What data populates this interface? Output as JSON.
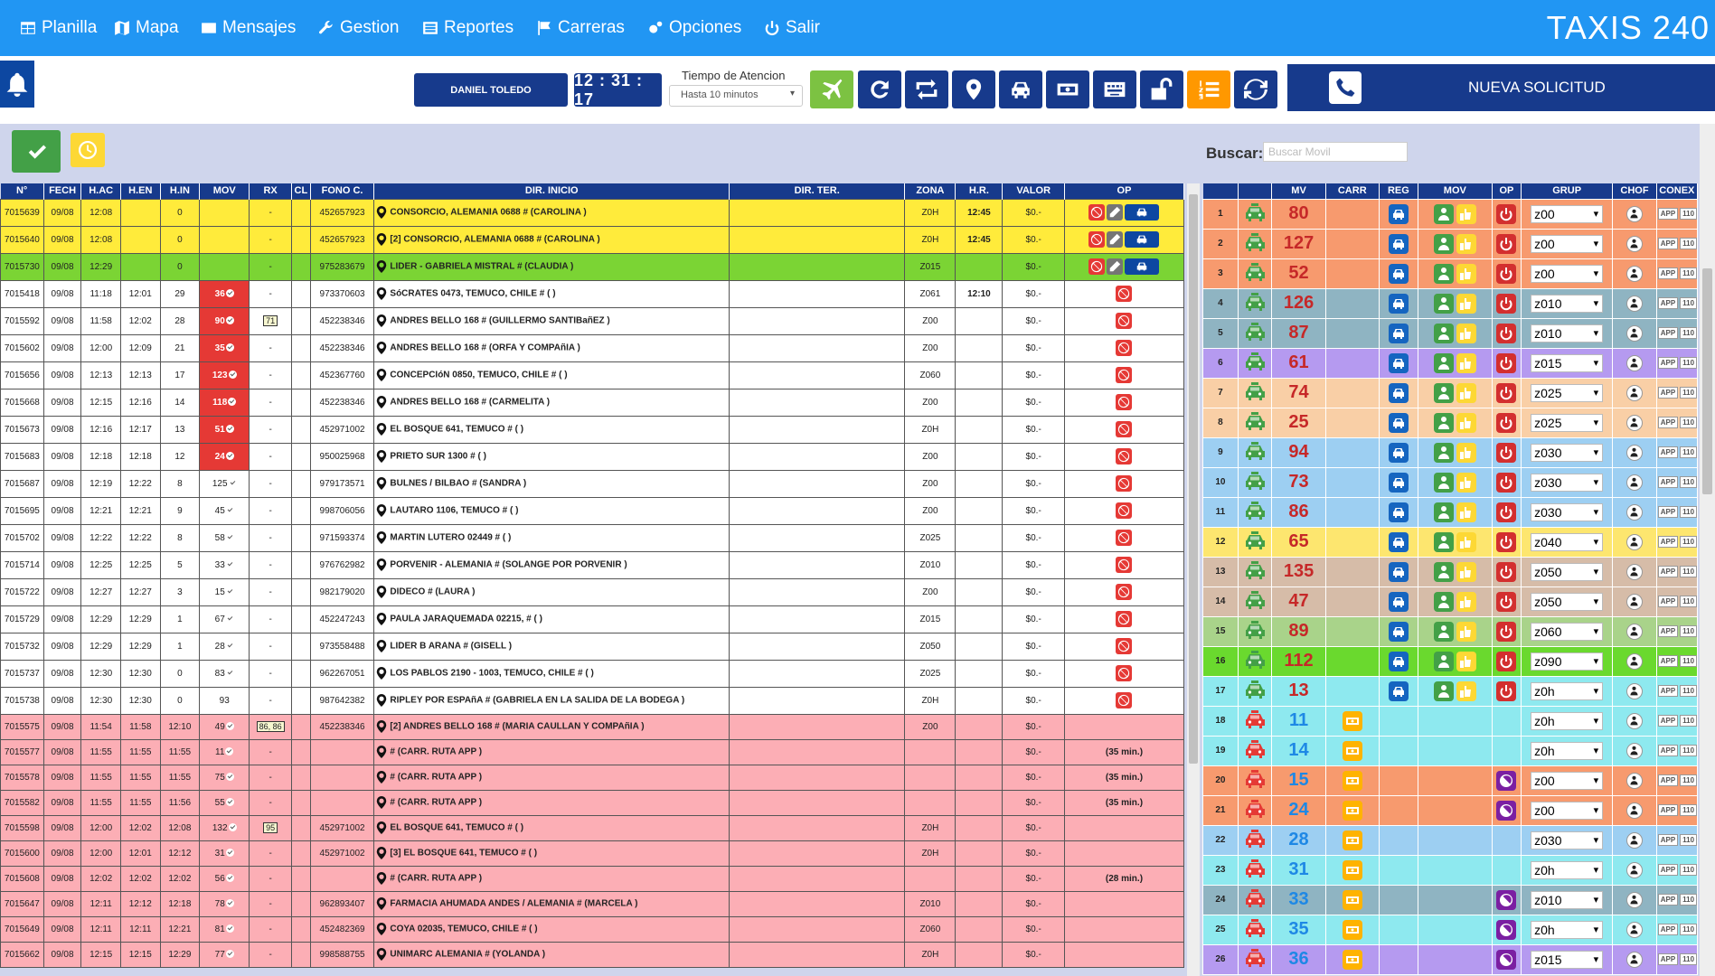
{
  "nav": {
    "items": [
      "Planilla",
      "Mapa",
      "Mensajes",
      "Gestion",
      "Reportes",
      "Carreras",
      "Opciones",
      "Salir"
    ],
    "brand": "TAXIS 240"
  },
  "toolbar": {
    "user": "DANIEL TOLEDO",
    "clock": "12 : 31 : 17",
    "tiempo_label": "Tiempo de Atencion",
    "tiempo_value": "Hasta 10 minutos",
    "nueva": "NUEVA SOLICITUD"
  },
  "search": {
    "label": "Buscar:",
    "placeholder": "Buscar Movil"
  },
  "left_headers": [
    "N°",
    "FECH",
    "H.AC",
    "H.EN",
    "H.IN",
    "MOV",
    "RX",
    "CL",
    "FONO C.",
    "DIR. INICIO",
    "DIR. TER.",
    "ZONA",
    "H.R.",
    "VALOR",
    "OP"
  ],
  "left_rows": [
    {
      "c": "y",
      "n": "7015639",
      "f": "09/08",
      "ac": "12:08",
      "en": "",
      "in": "0",
      "mov": "",
      "rx": "-",
      "fono": "452657923",
      "dir": "CONSORCIO, ALEMANIA 0688 # (CAROLINA )",
      "zona": "Z0H",
      "hr": "12:45",
      "val": "$0.-",
      "op": "full"
    },
    {
      "c": "y",
      "n": "7015640",
      "f": "09/08",
      "ac": "12:08",
      "en": "",
      "in": "0",
      "mov": "",
      "rx": "-",
      "fono": "452657923",
      "dir": "[2] CONSORCIO, ALEMANIA 0688 # (CAROLINA )",
      "zona": "Z0H",
      "hr": "12:45",
      "val": "$0.-",
      "op": "full"
    },
    {
      "c": "g",
      "n": "7015730",
      "f": "09/08",
      "ac": "12:29",
      "en": "",
      "in": "0",
      "mov": "",
      "rx": "-",
      "fono": "975283679",
      "dir": "LIDER - GABRIELA MISTRAL # (CLAUDIA )",
      "zona": "Z015",
      "hr": "",
      "val": "$0.-",
      "op": "full"
    },
    {
      "c": "w",
      "n": "7015418",
      "f": "09/08",
      "ac": "11:18",
      "en": "12:01",
      "in": "29",
      "mov": "36",
      "mr": true,
      "rx": "-",
      "fono": "973370603",
      "dir": "SóCRATES 0473, TEMUCO, CHILE # ( )",
      "zona": "Z061",
      "hr": "12:10",
      "val": "$0.-",
      "op": "ban"
    },
    {
      "c": "w",
      "n": "7015592",
      "f": "09/08",
      "ac": "11:58",
      "en": "12:02",
      "in": "28",
      "mov": "90",
      "mr": true,
      "rx": "71",
      "rxb": true,
      "fono": "452238346",
      "dir": "ANDRES BELLO 168 # (GUILLERMO SANTIBañEZ )",
      "zona": "Z00",
      "hr": "",
      "val": "$0.-",
      "op": "ban"
    },
    {
      "c": "w",
      "n": "7015602",
      "f": "09/08",
      "ac": "12:00",
      "en": "12:09",
      "in": "21",
      "mov": "35",
      "mr": true,
      "rx": "-",
      "fono": "452238346",
      "dir": "ANDRES BELLO 168 # (ORFA Y COMPAñIA )",
      "zona": "Z00",
      "hr": "",
      "val": "$0.-",
      "op": "ban"
    },
    {
      "c": "w",
      "n": "7015656",
      "f": "09/08",
      "ac": "12:13",
      "en": "12:13",
      "in": "17",
      "mov": "123",
      "mr": true,
      "rx": "-",
      "fono": "452367760",
      "dir": "CONCEPCIóN 0850, TEMUCO, CHILE # ( )",
      "zona": "Z060",
      "hr": "",
      "val": "$0.-",
      "op": "ban"
    },
    {
      "c": "w",
      "n": "7015668",
      "f": "09/08",
      "ac": "12:15",
      "en": "12:16",
      "in": "14",
      "mov": "118",
      "mr": true,
      "rx": "-",
      "fono": "452238346",
      "dir": "ANDRES BELLO 168 # (CARMELITA )",
      "zona": "Z00",
      "hr": "",
      "val": "$0.-",
      "op": "ban"
    },
    {
      "c": "w",
      "n": "7015673",
      "f": "09/08",
      "ac": "12:16",
      "en": "12:17",
      "in": "13",
      "mov": "51",
      "mr": true,
      "rx": "-",
      "fono": "452971002",
      "dir": "EL BOSQUE 641, TEMUCO # ( )",
      "zona": "Z0H",
      "hr": "",
      "val": "$0.-",
      "op": "ban"
    },
    {
      "c": "w",
      "n": "7015683",
      "f": "09/08",
      "ac": "12:18",
      "en": "12:18",
      "in": "12",
      "mov": "24",
      "mr": true,
      "rx": "-",
      "fono": "950025968",
      "dir": "PRIETO SUR 1300 # ( )",
      "zona": "Z00",
      "hr": "",
      "val": "$0.-",
      "op": "ban"
    },
    {
      "c": "w",
      "n": "7015687",
      "f": "09/08",
      "ac": "12:19",
      "en": "12:22",
      "in": "8",
      "mov": "125",
      "rx": "-",
      "fono": "979173571",
      "dir": "BULNES / BILBAO # (SANDRA )",
      "zona": "Z00",
      "hr": "",
      "val": "$0.-",
      "op": "ban"
    },
    {
      "c": "w",
      "n": "7015695",
      "f": "09/08",
      "ac": "12:21",
      "en": "12:21",
      "in": "9",
      "mov": "45",
      "rx": "-",
      "fono": "998706056",
      "dir": "LAUTARO 1106, TEMUCO # ( )",
      "zona": "Z00",
      "hr": "",
      "val": "$0.-",
      "op": "ban"
    },
    {
      "c": "w",
      "n": "7015702",
      "f": "09/08",
      "ac": "12:22",
      "en": "12:22",
      "in": "8",
      "mov": "58",
      "rx": "-",
      "fono": "971593374",
      "dir": "MARTIN LUTERO 02449 # ( )",
      "zona": "Z025",
      "hr": "",
      "val": "$0.-",
      "op": "ban"
    },
    {
      "c": "w",
      "n": "7015714",
      "f": "09/08",
      "ac": "12:25",
      "en": "12:25",
      "in": "5",
      "mov": "33",
      "rx": "-",
      "fono": "976762982",
      "dir": "PORVENIR - ALEMANIA # (SOLANGE POR PORVENIR )",
      "zona": "Z010",
      "hr": "",
      "val": "$0.-",
      "op": "ban"
    },
    {
      "c": "w",
      "n": "7015722",
      "f": "09/08",
      "ac": "12:27",
      "en": "12:27",
      "in": "3",
      "mov": "15",
      "rx": "-",
      "fono": "982179020",
      "dir": "DIDECO # (LAURA )",
      "zona": "Z00",
      "hr": "",
      "val": "$0.-",
      "op": "ban"
    },
    {
      "c": "w",
      "n": "7015729",
      "f": "09/08",
      "ac": "12:29",
      "en": "12:29",
      "in": "1",
      "mov": "67",
      "rx": "-",
      "fono": "452247243",
      "dir": "PAULA JARAQUEMADA 02215, # ( )",
      "zona": "Z015",
      "hr": "",
      "val": "$0.-",
      "op": "ban"
    },
    {
      "c": "w",
      "n": "7015732",
      "f": "09/08",
      "ac": "12:29",
      "en": "12:29",
      "in": "1",
      "mov": "28",
      "rx": "-",
      "fono": "973558488",
      "dir": "LIDER B ARANA # (GISELL )",
      "zona": "Z050",
      "hr": "",
      "val": "$0.-",
      "op": "ban"
    },
    {
      "c": "w",
      "n": "7015737",
      "f": "09/08",
      "ac": "12:30",
      "en": "12:30",
      "in": "0",
      "mov": "83",
      "rx": "-",
      "fono": "962267051",
      "dir": "LOS PABLOS 2190 - 1003, TEMUCO, CHILE # ( )",
      "zona": "Z025",
      "hr": "",
      "val": "$0.-",
      "op": "ban"
    },
    {
      "c": "w",
      "n": "7015738",
      "f": "09/08",
      "ac": "12:30",
      "en": "12:30",
      "in": "0",
      "mov": "93",
      "nock": true,
      "rx": "-",
      "fono": "987642382",
      "dir": "RIPLEY POR ESPAñA # (GABRIELA EN LA SALIDA DE LA BODEGA )",
      "zona": "Z0H",
      "hr": "",
      "val": "$0.-",
      "op": "ban"
    },
    {
      "c": "p",
      "n": "7015575",
      "f": "09/08",
      "ac": "11:54",
      "en": "11:58",
      "in": "12:10",
      "mov": "49",
      "rx": "86, 86",
      "rxb": true,
      "fono": "452238346",
      "dir": "[2] ANDRES BELLO 168 # (MARIA CAULLAN Y COMPAñIA )",
      "zona": "Z00",
      "hr": "",
      "val": "$0.-",
      "op": ""
    },
    {
      "c": "p",
      "n": "7015577",
      "f": "09/08",
      "ac": "11:55",
      "en": "11:55",
      "in": "11:55",
      "mov": "11",
      "rx": "-",
      "fono": "",
      "dir": "# (CARR. RUTA APP )",
      "zona": "",
      "hr": "",
      "val": "$0.-",
      "op": "(35 min.)"
    },
    {
      "c": "p",
      "n": "7015578",
      "f": "09/08",
      "ac": "11:55",
      "en": "11:55",
      "in": "11:55",
      "mov": "75",
      "rx": "-",
      "fono": "",
      "dir": "# (CARR. RUTA APP )",
      "zona": "",
      "hr": "",
      "val": "$0.-",
      "op": "(35 min.)"
    },
    {
      "c": "p",
      "n": "7015582",
      "f": "09/08",
      "ac": "11:55",
      "en": "11:55",
      "in": "11:56",
      "mov": "55",
      "rx": "-",
      "fono": "",
      "dir": "# (CARR. RUTA APP )",
      "zona": "",
      "hr": "",
      "val": "$0.-",
      "op": "(35 min.)"
    },
    {
      "c": "p",
      "n": "7015598",
      "f": "09/08",
      "ac": "12:00",
      "en": "12:02",
      "in": "12:08",
      "mov": "132",
      "rx": "95",
      "rxb": true,
      "fono": "452971002",
      "dir": "EL BOSQUE 641, TEMUCO # ( )",
      "zona": "Z0H",
      "hr": "",
      "val": "$0.-",
      "op": ""
    },
    {
      "c": "p",
      "n": "7015600",
      "f": "09/08",
      "ac": "12:00",
      "en": "12:01",
      "in": "12:12",
      "mov": "31",
      "rx": "-",
      "fono": "452971002",
      "dir": "[3] EL BOSQUE 641, TEMUCO # ( )",
      "zona": "Z0H",
      "hr": "",
      "val": "$0.-",
      "op": ""
    },
    {
      "c": "p",
      "n": "7015608",
      "f": "09/08",
      "ac": "12:02",
      "en": "12:02",
      "in": "12:02",
      "mov": "56",
      "rx": "-",
      "fono": "",
      "dir": "# (CARR. RUTA APP )",
      "zona": "",
      "hr": "",
      "val": "$0.-",
      "op": "(28 min.)"
    },
    {
      "c": "p",
      "n": "7015647",
      "f": "09/08",
      "ac": "12:11",
      "en": "12:12",
      "in": "12:18",
      "mov": "78",
      "rx": "-",
      "fono": "962893407",
      "dir": "FARMACIA AHUMADA ANDES / ALEMANIA # (MARCELA )",
      "zona": "Z010",
      "hr": "",
      "val": "$0.-",
      "op": ""
    },
    {
      "c": "p",
      "n": "7015649",
      "f": "09/08",
      "ac": "12:11",
      "en": "12:11",
      "in": "12:21",
      "mov": "81",
      "rx": "-",
      "fono": "452482369",
      "dir": "COYA 02035, TEMUCO, CHILE # ( )",
      "zona": "Z060",
      "hr": "",
      "val": "$0.-",
      "op": ""
    },
    {
      "c": "p",
      "n": "7015662",
      "f": "09/08",
      "ac": "12:15",
      "en": "12:15",
      "in": "12:29",
      "mov": "77",
      "rx": "-",
      "fono": "998588755",
      "dir": "UNIMARC ALEMANIA # (YOLANDA )",
      "zona": "Z0H",
      "hr": "",
      "val": "$0.-",
      "op": ""
    }
  ],
  "right_headers": [
    "",
    "MV",
    "CARR",
    "REG",
    "MOV",
    "OP",
    "GRUP",
    "CHOF",
    "CONEX"
  ],
  "right_rows": [
    {
      "n": "1",
      "mv": "80",
      "bg": "#f79a6e",
      "grp": "z00",
      "act": true
    },
    {
      "n": "2",
      "mv": "127",
      "bg": "#f79a6e",
      "grp": "z00",
      "act": true
    },
    {
      "n": "3",
      "mv": "52",
      "bg": "#f79a6e",
      "grp": "z00",
      "act": true
    },
    {
      "n": "4",
      "mv": "126",
      "bg": "#8fb4c2",
      "grp": "z010",
      "act": true
    },
    {
      "n": "5",
      "mv": "87",
      "bg": "#8fb4c2",
      "grp": "z010",
      "act": true
    },
    {
      "n": "6",
      "mv": "61",
      "bg": "#b59af0",
      "grp": "z015",
      "act": true
    },
    {
      "n": "7",
      "mv": "74",
      "bg": "#f9cfa6",
      "grp": "z025",
      "act": true
    },
    {
      "n": "8",
      "mv": "25",
      "bg": "#f9cfa6",
      "grp": "z025",
      "act": true
    },
    {
      "n": "9",
      "mv": "94",
      "bg": "#9dcff2",
      "grp": "z030",
      "act": true
    },
    {
      "n": "10",
      "mv": "73",
      "bg": "#9dcff2",
      "grp": "z030",
      "act": true
    },
    {
      "n": "11",
      "mv": "86",
      "bg": "#9dcff2",
      "grp": "z030",
      "act": true
    },
    {
      "n": "12",
      "mv": "65",
      "bg": "#fde66f",
      "grp": "z040",
      "act": true
    },
    {
      "n": "13",
      "mv": "135",
      "bg": "#d6bca8",
      "grp": "z050",
      "act": true
    },
    {
      "n": "14",
      "mv": "47",
      "bg": "#d6bca8",
      "grp": "z050",
      "act": true
    },
    {
      "n": "15",
      "mv": "89",
      "bg": "#a9d38a",
      "grp": "z060",
      "act": true
    },
    {
      "n": "16",
      "mv": "112",
      "bg": "#6ad92e",
      "grp": "z090",
      "act": true
    },
    {
      "n": "17",
      "mv": "13",
      "bg": "#8ee9ef",
      "grp": "z0h",
      "act": true
    },
    {
      "n": "18",
      "mv": "11",
      "bg": "#8ee9ef",
      "grp": "z0h",
      "act": false,
      "op": false
    },
    {
      "n": "19",
      "mv": "14",
      "bg": "#8ee9ef",
      "grp": "z0h",
      "act": false,
      "op": false
    },
    {
      "n": "20",
      "mv": "15",
      "bg": "#f79a6e",
      "grp": "z00",
      "act": false,
      "op": true
    },
    {
      "n": "21",
      "mv": "24",
      "bg": "#f79a6e",
      "grp": "z00",
      "act": false,
      "op": true
    },
    {
      "n": "22",
      "mv": "28",
      "bg": "#9dcff2",
      "grp": "z030",
      "act": false,
      "op": false
    },
    {
      "n": "23",
      "mv": "31",
      "bg": "#8ee9ef",
      "grp": "z0h",
      "act": false,
      "op": false
    },
    {
      "n": "24",
      "mv": "33",
      "bg": "#8fb4c2",
      "grp": "z010",
      "act": false,
      "op": true
    },
    {
      "n": "25",
      "mv": "35",
      "bg": "#8ee9ef",
      "grp": "z0h",
      "act": false,
      "op": true
    },
    {
      "n": "26",
      "mv": "36",
      "bg": "#b59af0",
      "grp": "z015",
      "act": false,
      "op": true
    }
  ],
  "conex": {
    "app": "APP",
    "num": "110"
  }
}
